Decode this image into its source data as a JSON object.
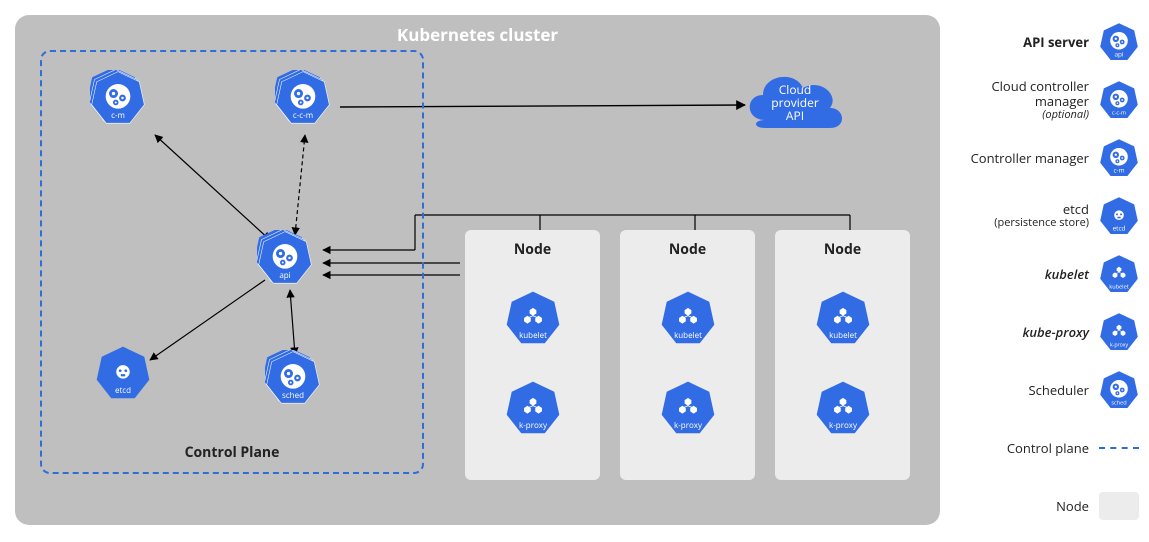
{
  "title": "Kubernetes cluster",
  "controlPlane": {
    "label": "Control Plane",
    "components": {
      "cm": "c-m",
      "ccm": "c-c-m",
      "api": "api",
      "etcd": "etcd",
      "sched": "sched"
    }
  },
  "cloud": {
    "line1": "Cloud",
    "line2": "provider",
    "line3": "API"
  },
  "nodes": {
    "title": "Node",
    "kubelet": "kubelet",
    "kproxy": "k-proxy"
  },
  "legend": {
    "api": {
      "label": "API server",
      "icon": "api"
    },
    "ccm": {
      "label": "Cloud controller manager",
      "sub": "(optional)",
      "icon": "c-c-m"
    },
    "cm": {
      "label": "Controller manager",
      "icon": "c-m"
    },
    "etcd": {
      "label": "etcd",
      "sub": "(persistence store)",
      "icon": "etcd"
    },
    "kubelet": {
      "label": "kubelet",
      "icon": "kubelet"
    },
    "kproxy": {
      "label": "kube-proxy",
      "icon": "k-proxy"
    },
    "sched": {
      "label": "Scheduler",
      "icon": "sched"
    },
    "cpline": {
      "label": "Control plane"
    },
    "node": {
      "label": "Node"
    }
  },
  "colors": {
    "k8sBlue": "#326ce5",
    "clusterBg": "#bfbfbf",
    "nodeBg": "#ececec"
  }
}
